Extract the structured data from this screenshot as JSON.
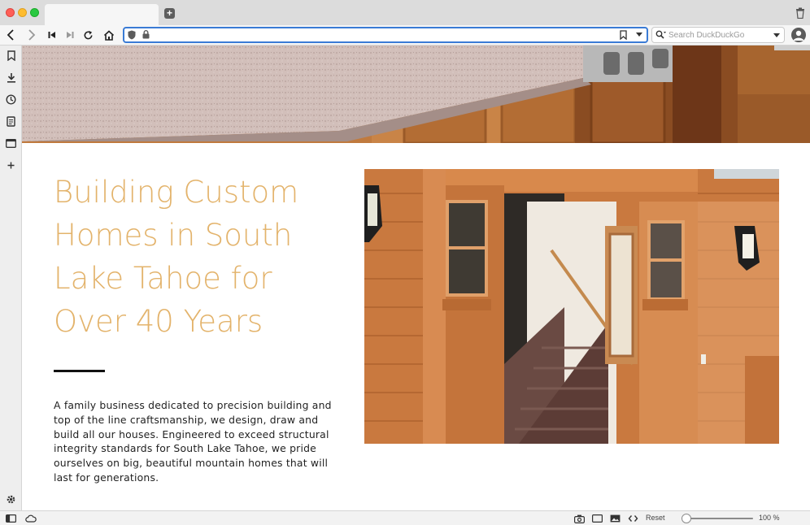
{
  "browser": {
    "tab": {
      "title": ""
    },
    "new_tab_label": "+",
    "address": {
      "url": ""
    },
    "search": {
      "placeholder": "Search DuckDuckGo"
    },
    "status": {
      "reset_label": "Reset",
      "zoom": "100 %",
      "zoom_level": 1.0
    }
  },
  "page": {
    "headline": "Building Custom Homes in South Lake Tahoe for Over 40 Years",
    "body": "A family business dedicated to precision building and top of the line craftsmanship, we design, draw and build all our houses. Engineered to exceed structural integrity standards for South Lake Tahoe, we pride ourselves on big, beautiful mountain homes that will last for generations.",
    "accent_color": "#e3b36b"
  },
  "icons": {
    "toolbar": [
      "back-icon",
      "forward-icon",
      "rewind-icon",
      "fast-forward-icon",
      "reload-icon",
      "home-icon"
    ],
    "side_panel": [
      "bookmarks-icon",
      "downloads-icon",
      "history-icon",
      "notes-icon",
      "window-panel-icon",
      "add-panel-icon",
      "settings-icon"
    ],
    "status_bar": [
      "panel-toggle-icon",
      "sync-cloud-icon",
      "capture-icon",
      "tile-icon",
      "images-icon",
      "code-icon"
    ]
  }
}
